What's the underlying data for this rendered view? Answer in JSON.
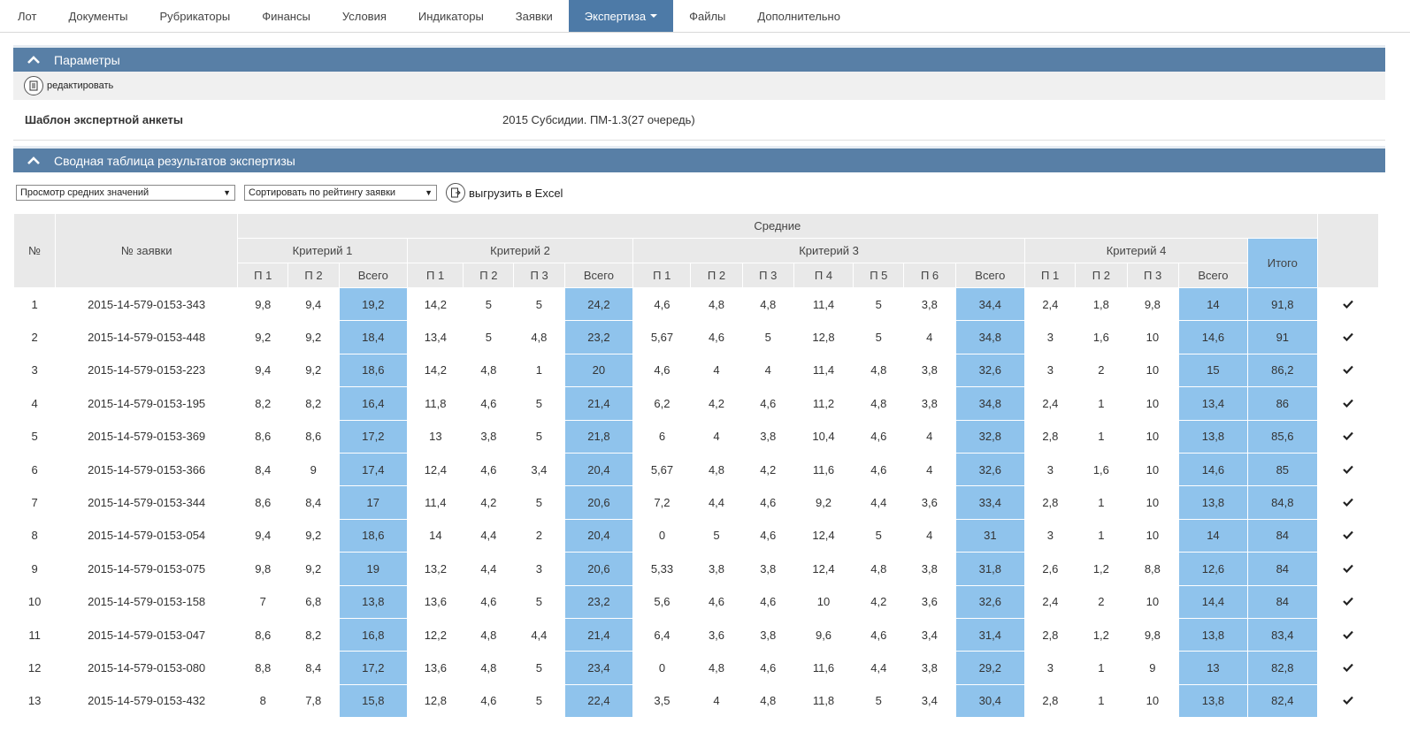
{
  "nav": {
    "tabs": [
      "Лот",
      "Документы",
      "Рубрикаторы",
      "Финансы",
      "Условия",
      "Индикаторы",
      "Заявки",
      "Экспертиза",
      "Файлы",
      "Дополнительно"
    ],
    "active": "Экспертиза"
  },
  "params": {
    "title": "Параметры",
    "edit_label": "редактировать",
    "template_label": "Шаблон экспертной анкеты",
    "template_value": "2015 Субсидии. ПМ-1.3(27 очередь)"
  },
  "summary": {
    "title": "Сводная таблица результатов экспертизы",
    "view_select": "Просмотр средних значений",
    "sort_select": "Сортировать по рейтингу заявки",
    "export_label": "выгрузить в Excel",
    "headers": {
      "num": "№",
      "app": "№ заявки",
      "avg": "Средние",
      "k1": "Критерий 1",
      "k2": "Критерий 2",
      "k3": "Критерий 3",
      "k4": "Критерий 4",
      "total": "Итого",
      "p1": "П 1",
      "p2": "П 2",
      "p3": "П 3",
      "p4": "П 4",
      "p5": "П 5",
      "p6": "П 6",
      "sum": "Всего"
    },
    "colors": {
      "header_bg": "#e9e9e9",
      "highlight": "#8fc3ec",
      "section": "#587fa6"
    },
    "rows": [
      {
        "n": "1",
        "app": "2015-14-579-0153-343",
        "k1": [
          "9,8",
          "9,4",
          "19,2"
        ],
        "k2": [
          "14,2",
          "5",
          "5",
          "24,2"
        ],
        "k3": [
          "4,6",
          "4,8",
          "4,8",
          "11,4",
          "5",
          "3,8",
          "34,4"
        ],
        "k4": [
          "2,4",
          "1,8",
          "9,8",
          "14"
        ],
        "total": "91,8"
      },
      {
        "n": "2",
        "app": "2015-14-579-0153-448",
        "k1": [
          "9,2",
          "9,2",
          "18,4"
        ],
        "k2": [
          "13,4",
          "5",
          "4,8",
          "23,2"
        ],
        "k3": [
          "5,67",
          "4,6",
          "5",
          "12,8",
          "5",
          "4",
          "34,8"
        ],
        "k4": [
          "3",
          "1,6",
          "10",
          "14,6"
        ],
        "total": "91"
      },
      {
        "n": "3",
        "app": "2015-14-579-0153-223",
        "k1": [
          "9,4",
          "9,2",
          "18,6"
        ],
        "k2": [
          "14,2",
          "4,8",
          "1",
          "20"
        ],
        "k3": [
          "4,6",
          "4",
          "4",
          "11,4",
          "4,8",
          "3,8",
          "32,6"
        ],
        "k4": [
          "3",
          "2",
          "10",
          "15"
        ],
        "total": "86,2"
      },
      {
        "n": "4",
        "app": "2015-14-579-0153-195",
        "k1": [
          "8,2",
          "8,2",
          "16,4"
        ],
        "k2": [
          "11,8",
          "4,6",
          "5",
          "21,4"
        ],
        "k3": [
          "6,2",
          "4,2",
          "4,6",
          "11,2",
          "4,8",
          "3,8",
          "34,8"
        ],
        "k4": [
          "2,4",
          "1",
          "10",
          "13,4"
        ],
        "total": "86"
      },
      {
        "n": "5",
        "app": "2015-14-579-0153-369",
        "k1": [
          "8,6",
          "8,6",
          "17,2"
        ],
        "k2": [
          "13",
          "3,8",
          "5",
          "21,8"
        ],
        "k3": [
          "6",
          "4",
          "3,8",
          "10,4",
          "4,6",
          "4",
          "32,8"
        ],
        "k4": [
          "2,8",
          "1",
          "10",
          "13,8"
        ],
        "total": "85,6"
      },
      {
        "n": "6",
        "app": "2015-14-579-0153-366",
        "k1": [
          "8,4",
          "9",
          "17,4"
        ],
        "k2": [
          "12,4",
          "4,6",
          "3,4",
          "20,4"
        ],
        "k3": [
          "5,67",
          "4,8",
          "4,2",
          "11,6",
          "4,6",
          "4",
          "32,6"
        ],
        "k4": [
          "3",
          "1,6",
          "10",
          "14,6"
        ],
        "total": "85"
      },
      {
        "n": "7",
        "app": "2015-14-579-0153-344",
        "k1": [
          "8,6",
          "8,4",
          "17"
        ],
        "k2": [
          "11,4",
          "4,2",
          "5",
          "20,6"
        ],
        "k3": [
          "7,2",
          "4,4",
          "4,6",
          "9,2",
          "4,4",
          "3,6",
          "33,4"
        ],
        "k4": [
          "2,8",
          "1",
          "10",
          "13,8"
        ],
        "total": "84,8"
      },
      {
        "n": "8",
        "app": "2015-14-579-0153-054",
        "k1": [
          "9,4",
          "9,2",
          "18,6"
        ],
        "k2": [
          "14",
          "4,4",
          "2",
          "20,4"
        ],
        "k3": [
          "0",
          "5",
          "4,6",
          "12,4",
          "5",
          "4",
          "31"
        ],
        "k4": [
          "3",
          "1",
          "10",
          "14"
        ],
        "total": "84"
      },
      {
        "n": "9",
        "app": "2015-14-579-0153-075",
        "k1": [
          "9,8",
          "9,2",
          "19"
        ],
        "k2": [
          "13,2",
          "4,4",
          "3",
          "20,6"
        ],
        "k3": [
          "5,33",
          "3,8",
          "3,8",
          "12,4",
          "4,8",
          "3,8",
          "31,8"
        ],
        "k4": [
          "2,6",
          "1,2",
          "8,8",
          "12,6"
        ],
        "total": "84"
      },
      {
        "n": "10",
        "app": "2015-14-579-0153-158",
        "k1": [
          "7",
          "6,8",
          "13,8"
        ],
        "k2": [
          "13,6",
          "4,6",
          "5",
          "23,2"
        ],
        "k3": [
          "5,6",
          "4,6",
          "4,6",
          "10",
          "4,2",
          "3,6",
          "32,6"
        ],
        "k4": [
          "2,4",
          "2",
          "10",
          "14,4"
        ],
        "total": "84"
      },
      {
        "n": "11",
        "app": "2015-14-579-0153-047",
        "k1": [
          "8,6",
          "8,2",
          "16,8"
        ],
        "k2": [
          "12,2",
          "4,8",
          "4,4",
          "21,4"
        ],
        "k3": [
          "6,4",
          "3,6",
          "3,8",
          "9,6",
          "4,6",
          "3,4",
          "31,4"
        ],
        "k4": [
          "2,8",
          "1,2",
          "9,8",
          "13,8"
        ],
        "total": "83,4"
      },
      {
        "n": "12",
        "app": "2015-14-579-0153-080",
        "k1": [
          "8,8",
          "8,4",
          "17,2"
        ],
        "k2": [
          "13,6",
          "4,8",
          "5",
          "23,4"
        ],
        "k3": [
          "0",
          "4,8",
          "4,6",
          "11,6",
          "4,4",
          "3,8",
          "29,2"
        ],
        "k4": [
          "3",
          "1",
          "9",
          "13"
        ],
        "total": "82,8"
      },
      {
        "n": "13",
        "app": "2015-14-579-0153-432",
        "k1": [
          "8",
          "7,8",
          "15,8"
        ],
        "k2": [
          "12,8",
          "4,6",
          "5",
          "22,4"
        ],
        "k3": [
          "3,5",
          "4",
          "4,8",
          "11,8",
          "5",
          "3,4",
          "30,4"
        ],
        "k4": [
          "2,8",
          "1",
          "10",
          "13,8"
        ],
        "total": "82,4"
      }
    ]
  }
}
